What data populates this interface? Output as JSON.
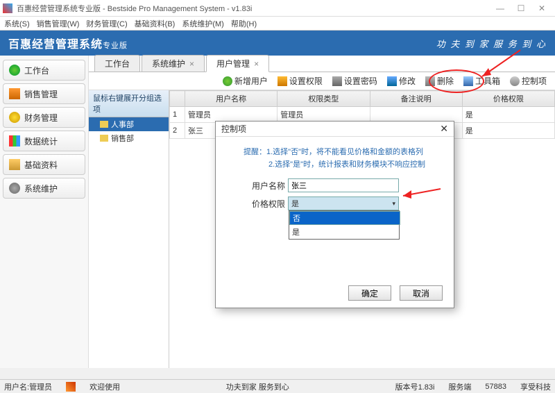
{
  "window": {
    "title": "百惠经营管理系统专业版 - Bestside Pro Management System - v1.83i"
  },
  "menubar": [
    "系统(S)",
    "销售管理(W)",
    "财务管理(C)",
    "基础资料(B)",
    "系统维护(M)",
    "帮助(H)"
  ],
  "banner": {
    "name": "百惠经营管理系统",
    "sub": "专业版",
    "slogan": "功 夫 到 家  服 务 到 心"
  },
  "sidebar": [
    {
      "label": "工作台"
    },
    {
      "label": "销售管理"
    },
    {
      "label": "财务管理"
    },
    {
      "label": "数据统计"
    },
    {
      "label": "基础资料"
    },
    {
      "label": "系统维护"
    }
  ],
  "tabs": [
    {
      "label": "工作台",
      "closable": false
    },
    {
      "label": "系统维护",
      "closable": true
    },
    {
      "label": "用户管理",
      "closable": true,
      "active": true
    }
  ],
  "toolbar": [
    {
      "label": "新增用户"
    },
    {
      "label": "设置权限"
    },
    {
      "label": "设置密码"
    },
    {
      "label": "修改"
    },
    {
      "label": "删除"
    },
    {
      "label": "工具箱"
    },
    {
      "label": "控制项"
    }
  ],
  "tree": {
    "header": "鼠标右键展开分组选项",
    "nodes": [
      {
        "label": "人事部",
        "selected": true
      },
      {
        "label": "销售部",
        "selected": false
      }
    ]
  },
  "grid": {
    "headers": [
      "",
      "用户名称",
      "权限类型",
      "备注说明",
      "价格权限"
    ],
    "rows": [
      [
        "1",
        "管理员",
        "管理员",
        "",
        "是"
      ],
      [
        "2",
        "张三",
        "",
        "",
        "是"
      ]
    ]
  },
  "dialog": {
    "title": "控制项",
    "hint1": "提醒：1.选择\"否\"时，将不能看见价格和金额的表格列",
    "hint2": "2.选择\"是\"时，统计报表和财务模块不响应控制",
    "labels": {
      "username": "用户名称",
      "pricePerm": "价格权限"
    },
    "username_value": "张三",
    "pricePerm_selected": "是",
    "dropdown_options": [
      "否",
      "是"
    ],
    "ok": "确定",
    "cancel": "取消"
  },
  "statusbar": {
    "user_label": "用户名:",
    "user_value": "管理员",
    "welcome": "欢迎使用",
    "slogan": "功夫到家 服务到心",
    "version_label": "版本号",
    "version": "1.83i",
    "server_label": "服务端",
    "port": "57883",
    "tech": "享受科技"
  }
}
